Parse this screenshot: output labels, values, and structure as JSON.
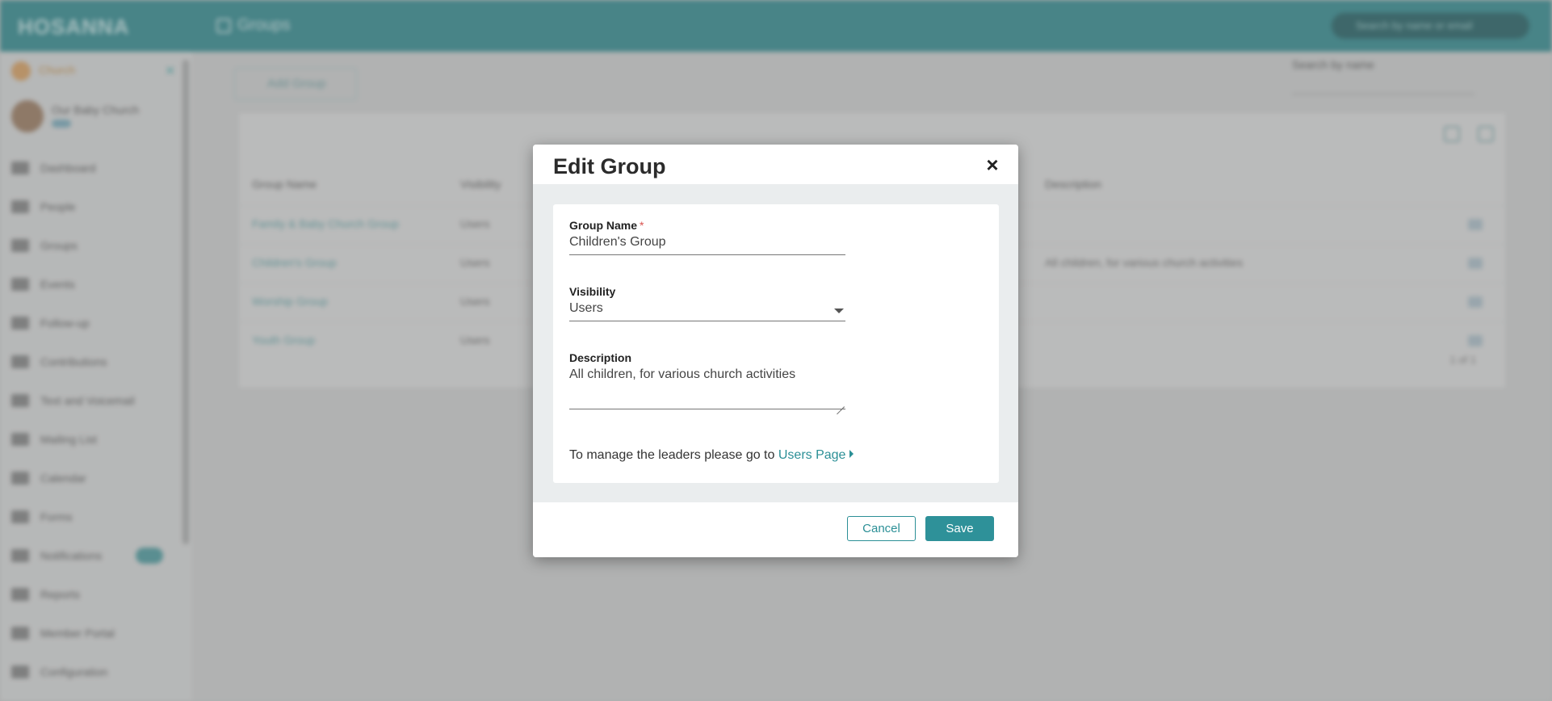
{
  "background": {
    "logo": "HOSANNA",
    "breadcrumb": "Groups",
    "search_placeholder": "Search by name or email",
    "sidebar": {
      "church": "Church",
      "user_name": "Our Baby Church",
      "items": [
        {
          "label": "Dashboard",
          "icon": "dashboard-icon"
        },
        {
          "label": "People",
          "icon": "people-icon"
        },
        {
          "label": "Groups",
          "icon": "groups-icon"
        },
        {
          "label": "Events",
          "icon": "events-icon"
        },
        {
          "label": "Follow-up",
          "icon": "followup-icon"
        },
        {
          "label": "Contributions",
          "icon": "contributions-icon"
        },
        {
          "label": "Text and Voicemail",
          "icon": "voicemail-icon"
        },
        {
          "label": "Mailing List",
          "icon": "mailing-icon"
        },
        {
          "label": "Calendar",
          "icon": "calendar-icon"
        },
        {
          "label": "Forms",
          "icon": "forms-icon"
        },
        {
          "label": "Notifications",
          "icon": "notifications-icon"
        },
        {
          "label": "Reports",
          "icon": "reports-icon"
        },
        {
          "label": "Member Portal",
          "icon": "portal-icon"
        },
        {
          "label": "Configuration",
          "icon": "configuration-icon"
        }
      ]
    },
    "add_group_label": "Add Group",
    "filter_label": "Search by name",
    "table": {
      "headers": [
        "Group Name",
        "Visibility",
        "Description"
      ],
      "rows": [
        {
          "name": "Family & Baby Church Group",
          "visibility": "Users",
          "description": ""
        },
        {
          "name": "Children's Group",
          "visibility": "Users",
          "description": "All children, for various church activities"
        },
        {
          "name": "Worship Group",
          "visibility": "Users",
          "description": ""
        },
        {
          "name": "Youth Group",
          "visibility": "Users",
          "description": ""
        }
      ],
      "pager": "1 of 1"
    }
  },
  "modal": {
    "title": "Edit Group",
    "close_symbol": "×",
    "fields": {
      "group_name": {
        "label": "Group Name",
        "required_mark": "*",
        "value": "Children's Group"
      },
      "visibility": {
        "label": "Visibility",
        "value": "Users"
      },
      "description": {
        "label": "Description",
        "value": "All children, for various church activities"
      }
    },
    "manage_text": "To manage the leaders please go to",
    "manage_link": "Users Page",
    "cancel_label": "Cancel",
    "save_label": "Save"
  },
  "colors": {
    "topbar": "#2e8a8f",
    "accent": "#2e9199",
    "required": "#d9534f"
  }
}
